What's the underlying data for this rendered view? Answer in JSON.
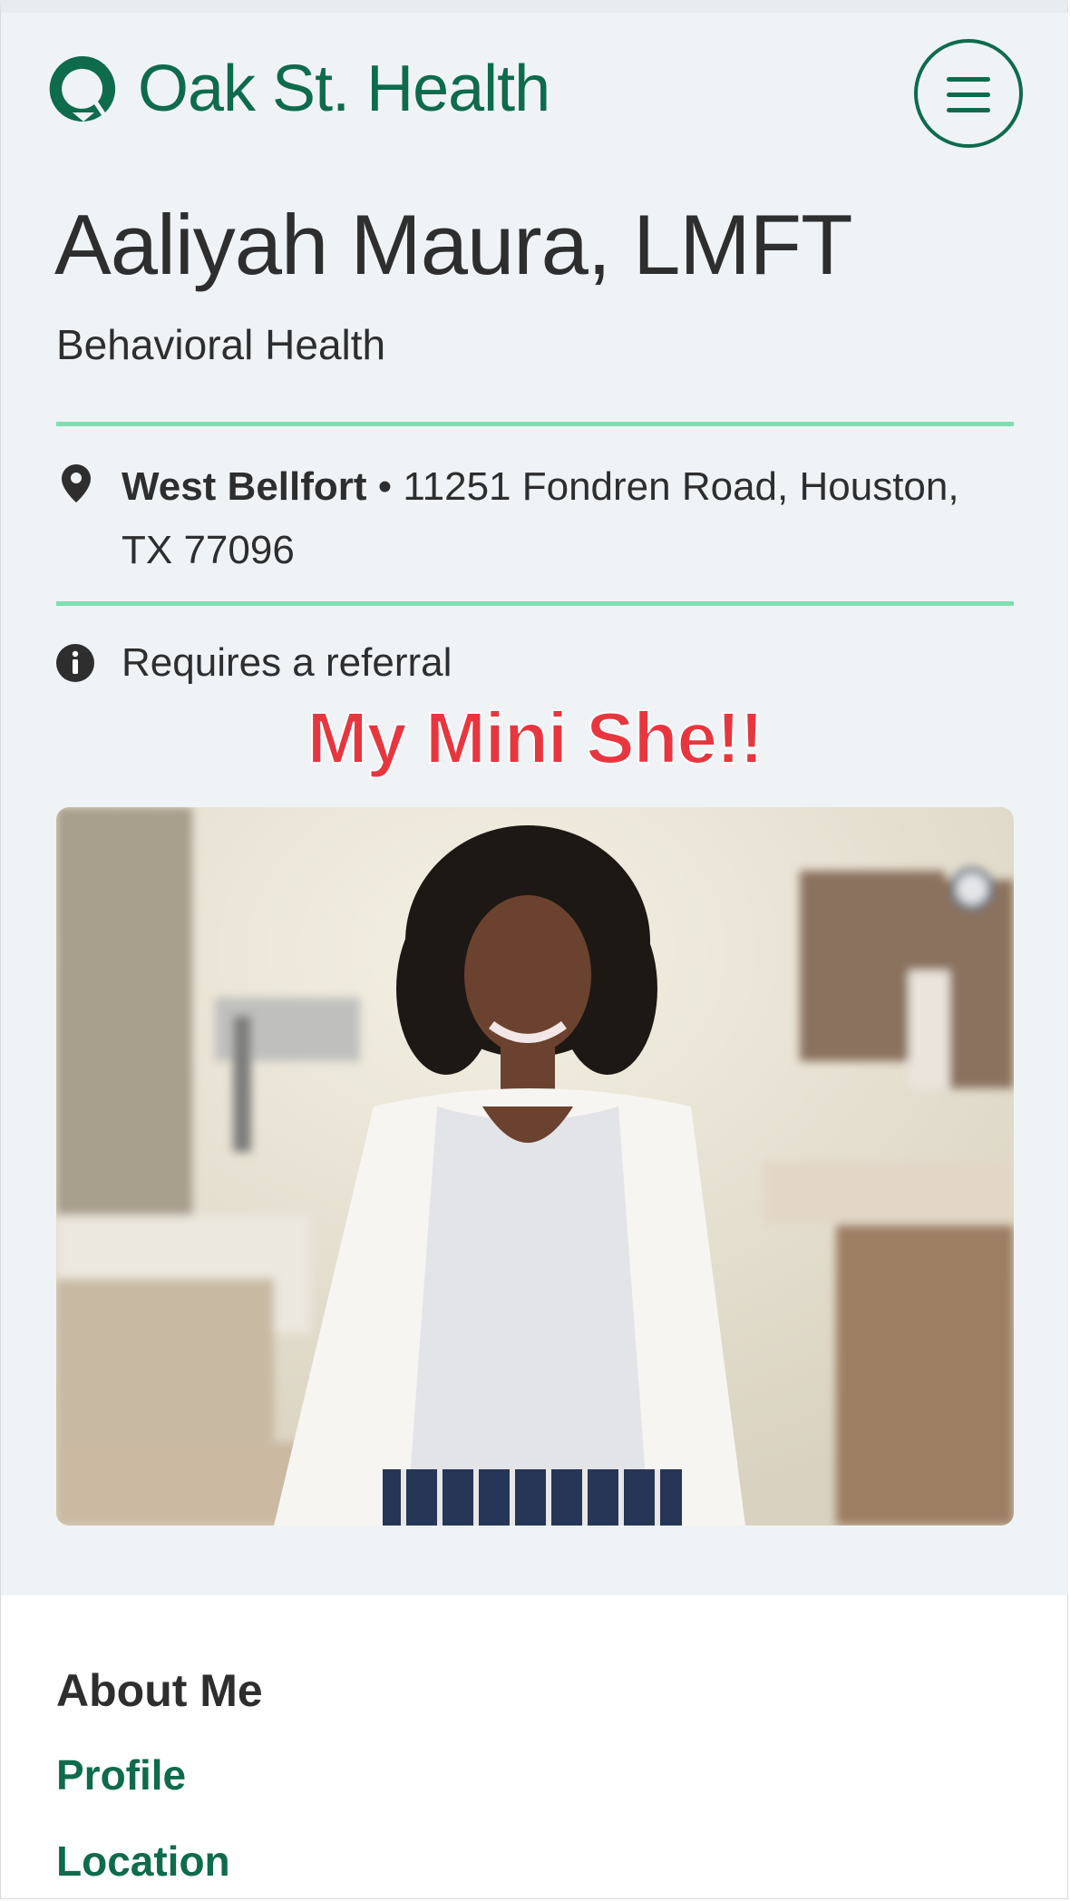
{
  "header": {
    "logo_text": "Oak St. Health",
    "brand_color": "#0e6b4c",
    "menu_icon": "hamburger-icon"
  },
  "provider": {
    "name": "Aaliyah Maura, LMFT",
    "specialty": "Behavioral Health"
  },
  "location": {
    "icon": "map-pin-icon",
    "clinic_name": "West Bellfort",
    "separator": " • ",
    "address": "11251 Fondren Road, Houston, TX 77096"
  },
  "notice": {
    "icon": "info-icon",
    "text": "Requires a referral"
  },
  "overlay_caption": "My Mini She!!",
  "colors": {
    "accent_rule": "#7fdfb1",
    "hero_background": "#eff3f5",
    "caption_red": "#e8363f"
  },
  "about": {
    "title": "About Me",
    "links": [
      "Profile",
      "Location"
    ]
  }
}
